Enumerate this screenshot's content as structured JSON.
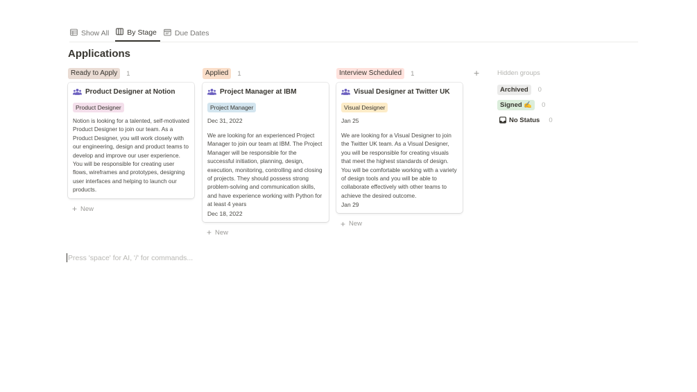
{
  "view_tabs": [
    {
      "label": "Show All",
      "icon": "table-icon"
    },
    {
      "label": "By Stage",
      "icon": "board-icon"
    },
    {
      "label": "Due Dates",
      "icon": "calendar-icon"
    }
  ],
  "title": "Applications",
  "columns": [
    {
      "stage": "Ready to Apply",
      "count": "1",
      "stage_color": "#eadcd4",
      "card": {
        "title": "Product Designer at Notion",
        "tag": "Product Designer",
        "tag_color": "#f4dfeb",
        "description": "Notion is looking for a talented, self-motivated Product Designer to join our team. As a Product Designer, you will work closely with our engineering, design and product teams to develop and improve our user experience. You will be responsible for creating user flows, wireframes and prototypes, designing user interfaces and helping to launch our products."
      },
      "new_label": "New"
    },
    {
      "stage": "Applied",
      "count": "1",
      "stage_color": "#fadec9",
      "card": {
        "title": "Project Manager at IBM",
        "tag": "Project Manager",
        "tag_color": "#d3e5ef",
        "date_top": "Dec 31, 2022",
        "description": "We are looking for an experienced Project Manager to join our team at IBM. The Project Manager will be responsible for the successful initiation, planning, design, execution, monitoring, controlling and closing of projects. They should possess strong problem-solving and communication skills, and have experience working with Python for at least 4 years",
        "date_bottom": "Dec 18, 2022"
      },
      "new_label": "New"
    },
    {
      "stage": "Interview Scheduled",
      "count": "1",
      "stage_color": "#ffe2dd",
      "card": {
        "title": "Visual Designer at Twitter UK",
        "tag": "Visual Designer",
        "tag_color": "#fdecc8",
        "date_top": "Jan 25",
        "description": "We are looking for a Visual Designer to join the Twitter UK team. As a Visual Designer, you will be responsible for creating visuals that meet the highest standards of design. You will be comfortable working with a variety of design tools and you will be able to collaborate effectively with other teams to achieve the desired outcome.",
        "date_bottom": "Jan 29"
      },
      "new_label": "New"
    }
  ],
  "add_group_label": "+",
  "hidden_groups": {
    "header": "Hidden groups",
    "items": [
      {
        "label": "Archived",
        "count": "0",
        "color": "#ebebea"
      },
      {
        "label": "Signed ✍️",
        "count": "0",
        "color": "#dbeddb"
      },
      {
        "label": "No Status",
        "count": "0",
        "icon": "inbox-icon"
      }
    ]
  },
  "command_placeholder": "Press 'space' for AI, '/' for commands..."
}
